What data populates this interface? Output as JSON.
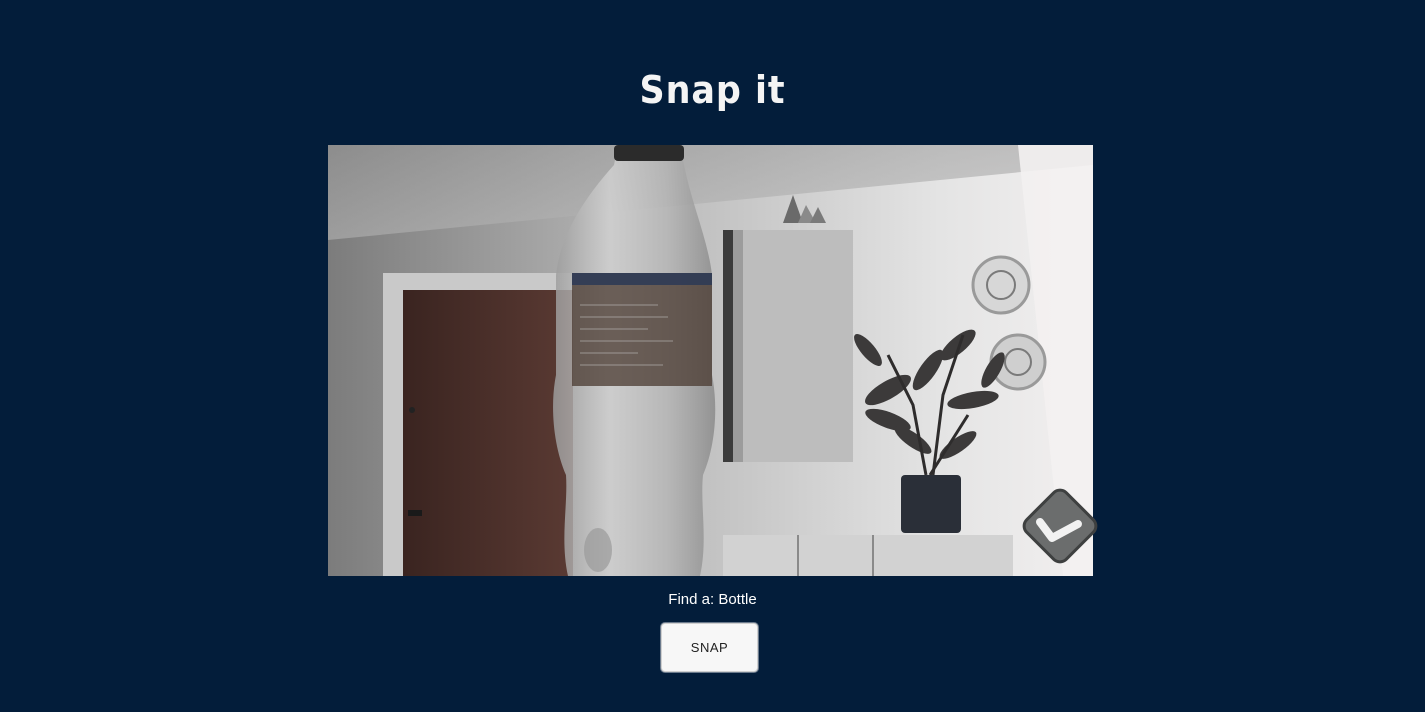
{
  "header": {
    "title": "Snap it"
  },
  "camera": {
    "feed_subject": "bottle",
    "overlay_icon": "checkmark-badge-icon"
  },
  "challenge": {
    "prefix": "Find a:",
    "target": "Bottle"
  },
  "actions": {
    "snap_label": "SNAP"
  },
  "colors": {
    "background": "#031d3a",
    "title": "#f4f4f4",
    "button_bg": "#f7f7f7"
  }
}
